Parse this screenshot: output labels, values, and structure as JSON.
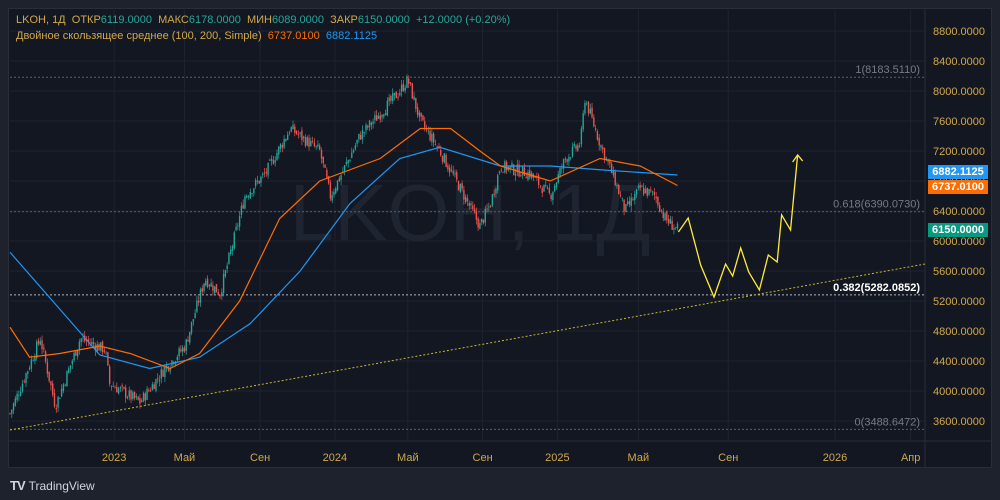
{
  "header": {
    "symbol": "LKOH, 1Д",
    "open_label": "ОТКР",
    "open": "6119.0000",
    "high_label": "МАКС",
    "high": "6178.0000",
    "low_label": "МИН",
    "low": "6089.0000",
    "close_label": "ЗАКР",
    "close": "6150.0000",
    "change": "+12.0000 (+0.20%)"
  },
  "indicator": {
    "name": "Двойное скользящее среднее (100, 200, Simple)",
    "ma100": "6737.0100",
    "ma200": "6882.1125"
  },
  "watermark": "LKOH, 1Д",
  "price_tags": {
    "ma200": "6882.1125",
    "ma100": "6737.0100",
    "last": "6150.0000"
  },
  "branding": "TradingView",
  "colors": {
    "up": "#26a69a",
    "down": "#ef5350",
    "ma100": "#ff6d00",
    "ma200": "#2196f3",
    "projection": "#ffeb3b",
    "axis_text": "#d1a84a"
  },
  "chart_data": {
    "type": "candlestick",
    "title": "LKOH, 1Д",
    "x_unit": "bar index",
    "ylim": [
      3400,
      8950
    ],
    "xlim": [
      0,
      1030
    ],
    "y_ticks": [
      3600,
      4000,
      4400,
      4800,
      5200,
      5600,
      6000,
      6400,
      6800,
      7200,
      7600,
      8000,
      8400,
      8800
    ],
    "y_tick_labels": [
      "3600.0000",
      "4000.0000",
      "4400.0000",
      "4800.0000",
      "5200.0000",
      "5600.0000",
      "6000.0000",
      "6400.0000",
      "6800.0000",
      "7200.0000",
      "7600.0000",
      "8000.0000",
      "8400.0000",
      "8800.0000"
    ],
    "x_ticks": [
      {
        "i": 117,
        "label": "2023"
      },
      {
        "i": 196,
        "label": "Май"
      },
      {
        "i": 281,
        "label": "Сен"
      },
      {
        "i": 365,
        "label": "2024"
      },
      {
        "i": 447,
        "label": "Май"
      },
      {
        "i": 531,
        "label": "Сен"
      },
      {
        "i": 615,
        "label": "2025"
      },
      {
        "i": 706,
        "label": "Май"
      },
      {
        "i": 807,
        "label": "Сен"
      },
      {
        "i": 927,
        "label": "2026"
      },
      {
        "i": 1012,
        "label": "Апр"
      }
    ],
    "price_path": [
      [
        0,
        3700
      ],
      [
        34,
        4700
      ],
      [
        51,
        3800
      ],
      [
        79,
        4700
      ],
      [
        107,
        4550
      ],
      [
        112,
        4100
      ],
      [
        146,
        3850
      ],
      [
        174,
        4300
      ],
      [
        197,
        4600
      ],
      [
        219,
        5500
      ],
      [
        236,
        5300
      ],
      [
        264,
        6600
      ],
      [
        287,
        6900
      ],
      [
        315,
        7500
      ],
      [
        348,
        7200
      ],
      [
        360,
        6600
      ],
      [
        377,
        7000
      ],
      [
        393,
        7400
      ],
      [
        416,
        7700
      ],
      [
        438,
        8000
      ],
      [
        447,
        8150
      ],
      [
        461,
        7600
      ],
      [
        483,
        7200
      ],
      [
        506,
        6700
      ],
      [
        528,
        6200
      ],
      [
        540,
        6500
      ],
      [
        551,
        7000
      ],
      [
        584,
        6900
      ],
      [
        607,
        6600
      ],
      [
        624,
        7100
      ],
      [
        641,
        7300
      ],
      [
        646,
        7900
      ],
      [
        663,
        7300
      ],
      [
        680,
        6800
      ],
      [
        691,
        6400
      ],
      [
        708,
        6700
      ],
      [
        725,
        6600
      ],
      [
        736,
        6300
      ],
      [
        750,
        6150
      ]
    ],
    "series": [
      {
        "name": "MA 200",
        "color": "#2196f3",
        "points": [
          [
            0,
            5850
          ],
          [
            101,
            4480
          ],
          [
            157,
            4300
          ],
          [
            213,
            4450
          ],
          [
            270,
            4900
          ],
          [
            326,
            5600
          ],
          [
            382,
            6500
          ],
          [
            438,
            7100
          ],
          [
            483,
            7250
          ],
          [
            551,
            7000
          ],
          [
            607,
            7000
          ],
          [
            663,
            6950
          ],
          [
            750,
            6880
          ]
        ]
      },
      {
        "name": "MA 100",
        "color": "#ff6d00",
        "points": [
          [
            0,
            4850
          ],
          [
            22,
            4450
          ],
          [
            56,
            4500
          ],
          [
            101,
            4600
          ],
          [
            135,
            4500
          ],
          [
            180,
            4300
          ],
          [
            213,
            4500
          ],
          [
            258,
            5200
          ],
          [
            303,
            6300
          ],
          [
            348,
            6800
          ],
          [
            416,
            7100
          ],
          [
            461,
            7500
          ],
          [
            495,
            7500
          ],
          [
            528,
            7200
          ],
          [
            551,
            7000
          ],
          [
            607,
            6800
          ],
          [
            663,
            7100
          ],
          [
            708,
            7000
          ],
          [
            750,
            6740
          ]
        ]
      },
      {
        "name": "Projection",
        "color": "#ffeb3b",
        "points": [
          [
            751,
            6120
          ],
          [
            762,
            6307
          ],
          [
            776,
            5680
          ],
          [
            791,
            5253
          ],
          [
            804,
            5693
          ],
          [
            812,
            5533
          ],
          [
            821,
            5907
          ],
          [
            830,
            5587
          ],
          [
            842,
            5347
          ],
          [
            852,
            5813
          ],
          [
            862,
            5720
          ],
          [
            867,
            6347
          ],
          [
            877,
            6147
          ],
          [
            885,
            7147
          ]
        ]
      }
    ],
    "trendline": [
      [
        0,
        3480
      ],
      [
        1028,
        5693
      ]
    ],
    "fib_levels": [
      {
        "level": "1",
        "price": 8183.511,
        "label": "1(8183.5110)"
      },
      {
        "level": "0.618",
        "price": 6390.073,
        "label": "0.618(6390.0730)"
      },
      {
        "level": "0.382",
        "price": 5282.0852,
        "label": "0.382(5282.0852)"
      },
      {
        "level": "0",
        "price": 3488.6472,
        "label": "0(3488.6472)"
      }
    ]
  }
}
